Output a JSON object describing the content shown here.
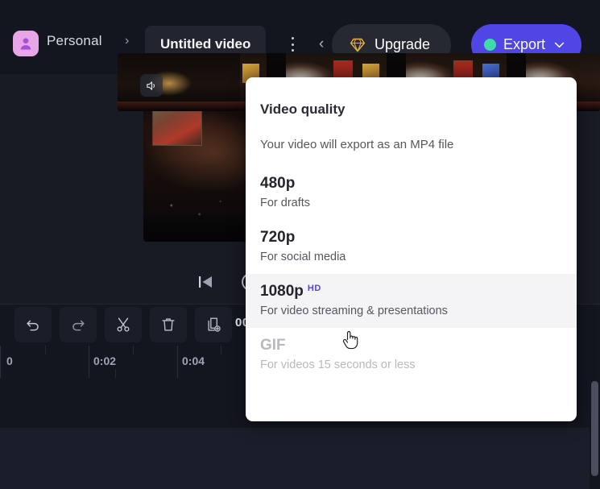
{
  "app": {
    "workspace": "Personal",
    "breadcrumb_separator": "›",
    "project_title": "Untitled video"
  },
  "topbar": {
    "upgrade_label": "Upgrade",
    "export_label": "Export",
    "upgrade_icon": "diamond-icon",
    "export_status_dot": "green-dot-icon",
    "export_chevron": "chevron-down-icon",
    "kebab_icon": "more-options-icon",
    "avatar_icon": "person-avatar-icon"
  },
  "colors": {
    "accent": "#4f46e5",
    "accent_dot": "#3ddbaa",
    "upgrade_gold": "#e8b33c",
    "avatar_pink": "#e8a6e8",
    "panel_bg": "#ffffff",
    "app_bg": "#14161f",
    "selected_row": "#f4f4f6"
  },
  "player": {
    "skip_start_icon": "skip-to-start-icon",
    "play_icon": "play-icon"
  },
  "toolbar": {
    "buttons": [
      {
        "name": "undo-button",
        "icon": "undo-icon"
      },
      {
        "name": "redo-button",
        "icon": "redo-icon"
      },
      {
        "name": "split-button",
        "icon": "scissors-icon"
      },
      {
        "name": "delete-button",
        "icon": "trash-icon"
      },
      {
        "name": "duplicate-button",
        "icon": "duplicate-icon"
      }
    ],
    "timecode": "00"
  },
  "timeline": {
    "ruler_labels": [
      "0",
      "0:02",
      "0:04"
    ],
    "mute_icon": "speaker-mute-icon",
    "clip_name": "video-clip"
  },
  "dropdown": {
    "title": "Video quality",
    "subtitle": "Your video will export as an MP4 file",
    "options": [
      {
        "label": "480p",
        "badge": "",
        "desc": "For drafts",
        "selected": false,
        "disabled": false
      },
      {
        "label": "720p",
        "badge": "",
        "desc": "For social media",
        "selected": false,
        "disabled": false
      },
      {
        "label": "1080p",
        "badge": "HD",
        "desc": "For video streaming & presentations",
        "selected": true,
        "disabled": false
      },
      {
        "label": "GIF",
        "badge": "",
        "desc": "For videos 15 seconds or less",
        "selected": false,
        "disabled": true
      }
    ]
  }
}
